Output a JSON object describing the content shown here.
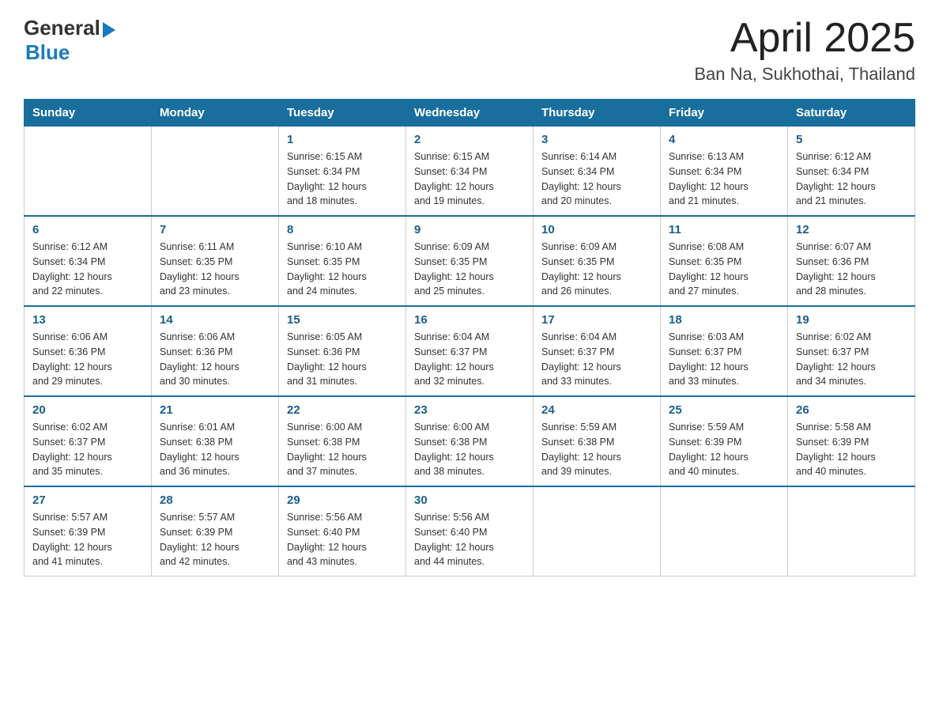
{
  "header": {
    "logo": {
      "general": "General",
      "arrow": "▶",
      "blue": "Blue"
    },
    "title": "April 2025",
    "location": "Ban Na, Sukhothai, Thailand"
  },
  "days_of_week": [
    "Sunday",
    "Monday",
    "Tuesday",
    "Wednesday",
    "Thursday",
    "Friday",
    "Saturday"
  ],
  "weeks": [
    [
      {
        "day": "",
        "info": ""
      },
      {
        "day": "",
        "info": ""
      },
      {
        "day": "1",
        "info": "Sunrise: 6:15 AM\nSunset: 6:34 PM\nDaylight: 12 hours\nand 18 minutes."
      },
      {
        "day": "2",
        "info": "Sunrise: 6:15 AM\nSunset: 6:34 PM\nDaylight: 12 hours\nand 19 minutes."
      },
      {
        "day": "3",
        "info": "Sunrise: 6:14 AM\nSunset: 6:34 PM\nDaylight: 12 hours\nand 20 minutes."
      },
      {
        "day": "4",
        "info": "Sunrise: 6:13 AM\nSunset: 6:34 PM\nDaylight: 12 hours\nand 21 minutes."
      },
      {
        "day": "5",
        "info": "Sunrise: 6:12 AM\nSunset: 6:34 PM\nDaylight: 12 hours\nand 21 minutes."
      }
    ],
    [
      {
        "day": "6",
        "info": "Sunrise: 6:12 AM\nSunset: 6:34 PM\nDaylight: 12 hours\nand 22 minutes."
      },
      {
        "day": "7",
        "info": "Sunrise: 6:11 AM\nSunset: 6:35 PM\nDaylight: 12 hours\nand 23 minutes."
      },
      {
        "day": "8",
        "info": "Sunrise: 6:10 AM\nSunset: 6:35 PM\nDaylight: 12 hours\nand 24 minutes."
      },
      {
        "day": "9",
        "info": "Sunrise: 6:09 AM\nSunset: 6:35 PM\nDaylight: 12 hours\nand 25 minutes."
      },
      {
        "day": "10",
        "info": "Sunrise: 6:09 AM\nSunset: 6:35 PM\nDaylight: 12 hours\nand 26 minutes."
      },
      {
        "day": "11",
        "info": "Sunrise: 6:08 AM\nSunset: 6:35 PM\nDaylight: 12 hours\nand 27 minutes."
      },
      {
        "day": "12",
        "info": "Sunrise: 6:07 AM\nSunset: 6:36 PM\nDaylight: 12 hours\nand 28 minutes."
      }
    ],
    [
      {
        "day": "13",
        "info": "Sunrise: 6:06 AM\nSunset: 6:36 PM\nDaylight: 12 hours\nand 29 minutes."
      },
      {
        "day": "14",
        "info": "Sunrise: 6:06 AM\nSunset: 6:36 PM\nDaylight: 12 hours\nand 30 minutes."
      },
      {
        "day": "15",
        "info": "Sunrise: 6:05 AM\nSunset: 6:36 PM\nDaylight: 12 hours\nand 31 minutes."
      },
      {
        "day": "16",
        "info": "Sunrise: 6:04 AM\nSunset: 6:37 PM\nDaylight: 12 hours\nand 32 minutes."
      },
      {
        "day": "17",
        "info": "Sunrise: 6:04 AM\nSunset: 6:37 PM\nDaylight: 12 hours\nand 33 minutes."
      },
      {
        "day": "18",
        "info": "Sunrise: 6:03 AM\nSunset: 6:37 PM\nDaylight: 12 hours\nand 33 minutes."
      },
      {
        "day": "19",
        "info": "Sunrise: 6:02 AM\nSunset: 6:37 PM\nDaylight: 12 hours\nand 34 minutes."
      }
    ],
    [
      {
        "day": "20",
        "info": "Sunrise: 6:02 AM\nSunset: 6:37 PM\nDaylight: 12 hours\nand 35 minutes."
      },
      {
        "day": "21",
        "info": "Sunrise: 6:01 AM\nSunset: 6:38 PM\nDaylight: 12 hours\nand 36 minutes."
      },
      {
        "day": "22",
        "info": "Sunrise: 6:00 AM\nSunset: 6:38 PM\nDaylight: 12 hours\nand 37 minutes."
      },
      {
        "day": "23",
        "info": "Sunrise: 6:00 AM\nSunset: 6:38 PM\nDaylight: 12 hours\nand 38 minutes."
      },
      {
        "day": "24",
        "info": "Sunrise: 5:59 AM\nSunset: 6:38 PM\nDaylight: 12 hours\nand 39 minutes."
      },
      {
        "day": "25",
        "info": "Sunrise: 5:59 AM\nSunset: 6:39 PM\nDaylight: 12 hours\nand 40 minutes."
      },
      {
        "day": "26",
        "info": "Sunrise: 5:58 AM\nSunset: 6:39 PM\nDaylight: 12 hours\nand 40 minutes."
      }
    ],
    [
      {
        "day": "27",
        "info": "Sunrise: 5:57 AM\nSunset: 6:39 PM\nDaylight: 12 hours\nand 41 minutes."
      },
      {
        "day": "28",
        "info": "Sunrise: 5:57 AM\nSunset: 6:39 PM\nDaylight: 12 hours\nand 42 minutes."
      },
      {
        "day": "29",
        "info": "Sunrise: 5:56 AM\nSunset: 6:40 PM\nDaylight: 12 hours\nand 43 minutes."
      },
      {
        "day": "30",
        "info": "Sunrise: 5:56 AM\nSunset: 6:40 PM\nDaylight: 12 hours\nand 44 minutes."
      },
      {
        "day": "",
        "info": ""
      },
      {
        "day": "",
        "info": ""
      },
      {
        "day": "",
        "info": ""
      }
    ]
  ]
}
